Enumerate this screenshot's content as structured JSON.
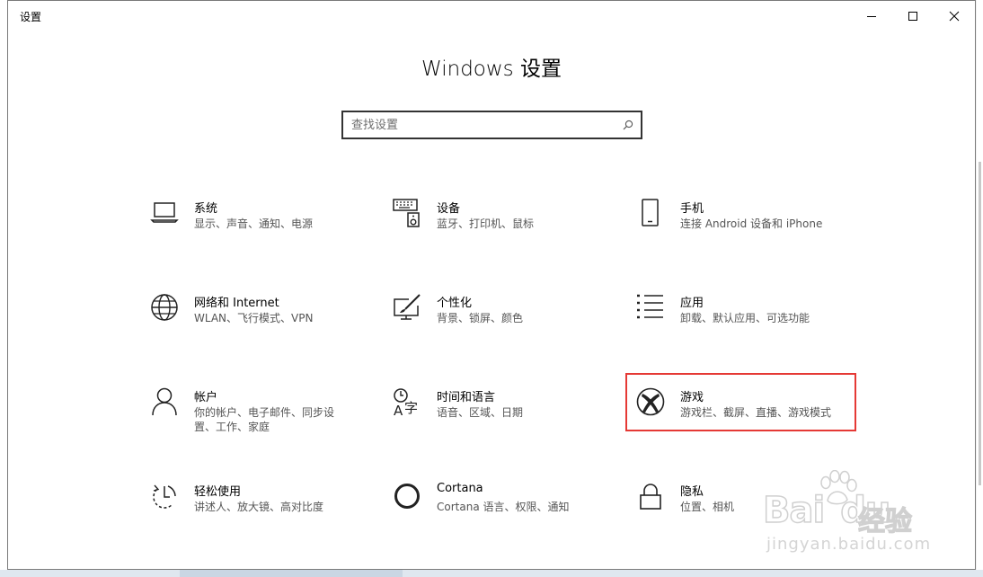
{
  "window": {
    "title": "设置"
  },
  "page": {
    "title": "Windows 设置"
  },
  "search": {
    "placeholder": "查找设置",
    "value": ""
  },
  "tiles": [
    {
      "name": "系统",
      "desc": "显示、声音、通知、电源",
      "icon": "laptop-icon"
    },
    {
      "name": "设备",
      "desc": "蓝牙、打印机、鼠标",
      "icon": "devices-icon"
    },
    {
      "name": "手机",
      "desc": "连接 Android 设备和 iPhone",
      "icon": "phone-icon"
    },
    {
      "name": "网络和 Internet",
      "desc": "WLAN、飞行模式、VPN",
      "icon": "globe-icon"
    },
    {
      "name": "个性化",
      "desc": "背景、锁屏、颜色",
      "icon": "personalization-icon"
    },
    {
      "name": "应用",
      "desc": "卸载、默认应用、可选功能",
      "icon": "apps-list-icon"
    },
    {
      "name": "帐户",
      "desc": "你的帐户、电子邮件、同步设置、工作、家庭",
      "icon": "person-icon"
    },
    {
      "name": "时间和语言",
      "desc": "语音、区域、日期",
      "icon": "time-language-icon"
    },
    {
      "name": "游戏",
      "desc": "游戏栏、截屏、直播、游戏模式",
      "icon": "xbox-icon"
    },
    {
      "name": "轻松使用",
      "desc": "讲述人、放大镜、高对比度",
      "icon": "ease-of-access-icon"
    },
    {
      "name": "Cortana",
      "desc": "Cortana 语言、权限、通知",
      "icon": "cortana-icon"
    },
    {
      "name": "隐私",
      "desc": "位置、相机",
      "icon": "lock-icon"
    }
  ],
  "highlight_color": "#e53935",
  "watermark": {
    "brand": "Bai",
    "brand2": "du",
    "brand_cn": "经验",
    "url": "jingyan.baidu.com"
  }
}
